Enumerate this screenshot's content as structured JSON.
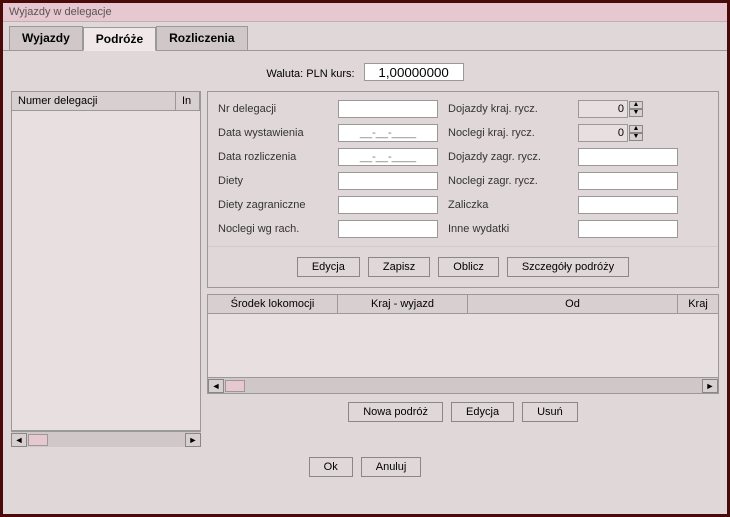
{
  "window_title": "Wyjazdy w delegacje",
  "tabs": {
    "wyjazdy": "Wyjazdy",
    "podroze": "Podróże",
    "rozliczenia": "Rozliczenia"
  },
  "currency": {
    "label": "Waluta: PLN kurs:",
    "value": "1,00000000"
  },
  "left_grid": {
    "col1": "Numer delegacji",
    "col2": "In"
  },
  "form": {
    "nr_delegacji": "Nr delegacji",
    "data_wyst": "Data wystawienia",
    "data_rozl": "Data rozliczenia",
    "diety": "Diety",
    "diety_zagr": "Diety zagraniczne",
    "noclegi_rach": "Noclegi wg rach.",
    "dojazdy_kraj": "Dojazdy kraj. rycz.",
    "noclegi_kraj": "Noclegi kraj. rycz.",
    "dojazdy_zagr": "Dojazdy zagr. rycz.",
    "noclegi_zagr": "Noclegi zagr. rycz.",
    "zaliczka": "Zaliczka",
    "inne": "Inne wydatki",
    "date_placeholder": "__-__-____",
    "spin_val": "0"
  },
  "buttons": {
    "edycja": "Edycja",
    "zapisz": "Zapisz",
    "oblicz": "Oblicz",
    "szczegoly": "Szczegóły podróży",
    "nowa_podroz": "Nowa podróż",
    "usun": "Usuń",
    "ok": "Ok",
    "anuluj": "Anuluj"
  },
  "travel_grid": {
    "srodek": "Środek lokomocji",
    "kraj_wyjazd": "Kraj - wyjazd",
    "od": "Od",
    "kraj": "Kraj"
  }
}
